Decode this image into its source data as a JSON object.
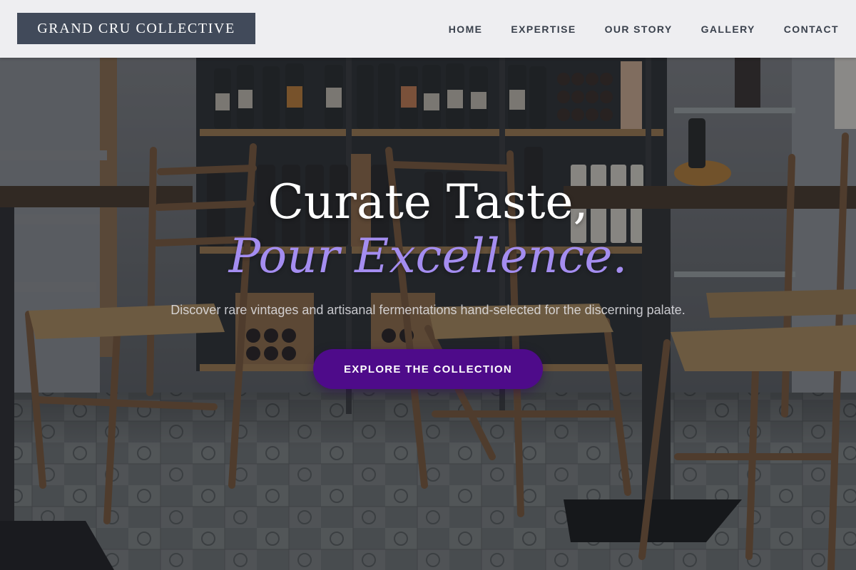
{
  "brand": {
    "logo_text": "GRAND CRU COLLECTIVE"
  },
  "nav": {
    "items": [
      {
        "label": "HOME"
      },
      {
        "label": "EXPERTISE"
      },
      {
        "label": "OUR STORY"
      },
      {
        "label": "GALLERY"
      },
      {
        "label": "CONTACT"
      }
    ]
  },
  "hero": {
    "headline": "Curate Taste,",
    "headline_accent": "Pour Excellence.",
    "subtext": "Discover rare vintages and artisanal fermentations hand-selected for the discerning palate.",
    "cta_label": "EXPLORE THE COLLECTION"
  },
  "colors": {
    "logo_bg": "#414a5a",
    "nav_text": "#39404c",
    "accent": "#a48df0",
    "cta_bg": "#4e0b8a"
  },
  "icons": {
    "hero_image": "wine-bar-interior-photo"
  }
}
